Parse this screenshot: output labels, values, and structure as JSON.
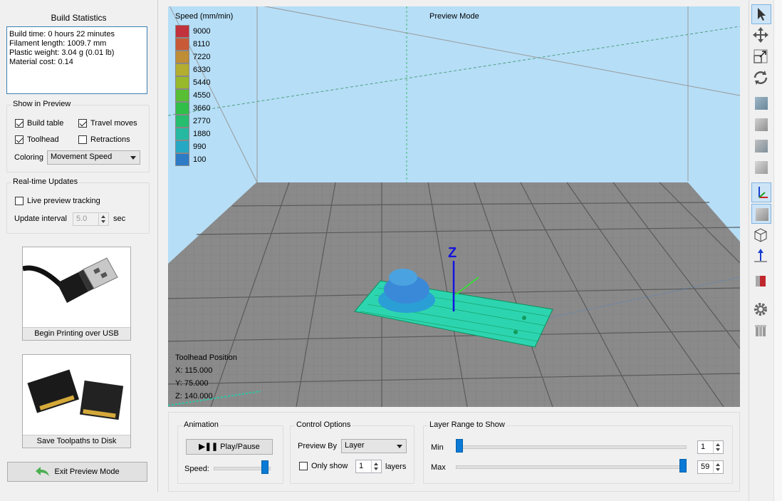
{
  "left_panel": {
    "title": "Build Statistics",
    "stats": [
      "Build time: 0 hours 22 minutes",
      "Filament length: 1009.7 mm",
      "Plastic weight: 3.04 g (0.01 lb)",
      "Material cost: 0.14"
    ],
    "show_in_preview": {
      "title": "Show in Preview",
      "build_table": {
        "label": "Build table",
        "checked": true
      },
      "travel_moves": {
        "label": "Travel moves",
        "checked": true
      },
      "toolhead": {
        "label": "Toolhead",
        "checked": true
      },
      "retractions": {
        "label": "Retractions",
        "checked": false
      },
      "coloring_label": "Coloring",
      "coloring_value": "Movement Speed"
    },
    "realtime": {
      "title": "Real-time Updates",
      "live_tracking": {
        "label": "Live preview tracking",
        "checked": false
      },
      "interval_label": "Update interval",
      "interval_value": "5.0",
      "interval_unit": "sec"
    },
    "usb_button": "Begin Printing over USB",
    "disk_button": "Save Toolpaths to Disk",
    "exit_button": "Exit Preview Mode"
  },
  "viewport": {
    "mode_label": "Preview Mode",
    "legend_title": "Speed (mm/min)",
    "legend": [
      {
        "value": "9000",
        "color": "#c1323c"
      },
      {
        "value": "8110",
        "color": "#c95a37"
      },
      {
        "value": "7220",
        "color": "#be8d35"
      },
      {
        "value": "6330",
        "color": "#b3ad30"
      },
      {
        "value": "5440",
        "color": "#97b92b"
      },
      {
        "value": "4550",
        "color": "#58be34"
      },
      {
        "value": "3660",
        "color": "#30bf48"
      },
      {
        "value": "2770",
        "color": "#27bd6f"
      },
      {
        "value": "1880",
        "color": "#26b9a2"
      },
      {
        "value": "990",
        "color": "#25a8c4"
      },
      {
        "value": "100",
        "color": "#2d7bc5"
      }
    ],
    "axis_z_label": "Z",
    "toolhead": {
      "title": "Toolhead Position",
      "x": "X: 115.000",
      "y": "Y: 75.000",
      "z": "Z: 140.000"
    }
  },
  "controls": {
    "animation": {
      "title": "Animation",
      "play_label": "Play/Pause",
      "speed_label": "Speed:",
      "speed_level": 0.95
    },
    "control_options": {
      "title": "Control Options",
      "preview_by_label": "Preview By",
      "preview_by_value": "Layer",
      "only_show_label": "Only show",
      "only_show_checked": false,
      "only_show_value": "1",
      "layers_label": "layers"
    },
    "layer_range": {
      "title": "Layer Range to Show",
      "min_label": "Min",
      "min_value": "1",
      "max_label": "Max",
      "max_value": "59",
      "min_level": 0.0,
      "max_level": 1.0
    }
  },
  "toolbar": {
    "tools": [
      "select-icon",
      "move-icon",
      "scale-icon",
      "rotate-icon",
      "view-front-icon",
      "view-side-icon",
      "view-top-icon",
      "view-iso-icon",
      "axes-icon",
      "solid-cube-icon",
      "wireframe-icon",
      "build-direction-icon",
      "section-icon",
      "settings-gear-icon",
      "supports-icon"
    ]
  }
}
